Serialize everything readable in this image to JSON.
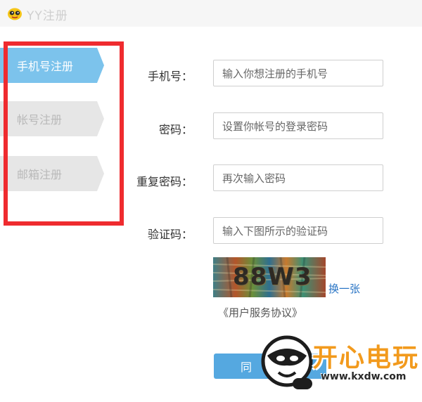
{
  "window": {
    "title": "YY注册"
  },
  "tabs": [
    {
      "label": "手机号注册",
      "active": true
    },
    {
      "label": "帐号注册",
      "active": false
    },
    {
      "label": "邮箱注册",
      "active": false
    }
  ],
  "form": {
    "phone": {
      "label": "手机号：",
      "placeholder": "输入你想注册的手机号"
    },
    "password": {
      "label": "密码：",
      "placeholder": "设置你帐号的登录密码"
    },
    "password_confirm": {
      "label": "重复密码：",
      "placeholder": "再次输入密码"
    },
    "captcha": {
      "label": "验证码：",
      "placeholder": "输入下图所示的验证码",
      "image_text": "88W3",
      "refresh_label": "换一张"
    },
    "agreement": "《用户服务协议》",
    "submit_label": "同"
  },
  "watermark": {
    "brand": "开心电玩",
    "url": "www.kxdw.com"
  },
  "colors": {
    "active_tab": "#7cc3ec",
    "inactive_tab": "#e6e6e6",
    "highlight": "#ef2b2f",
    "link": "#2a75c5",
    "button": "#55a8e0",
    "watermark": "#f29a1d"
  }
}
